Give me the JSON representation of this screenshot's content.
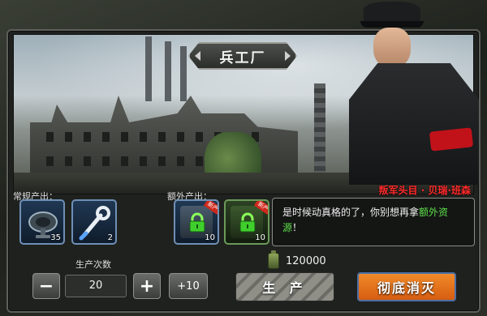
{
  "title": "兵工厂",
  "boss": {
    "name": "叛军头目 · 贝瑞·班森"
  },
  "regular_output": {
    "label": "常规产出：",
    "items": [
      {
        "icon": "radar-dish-icon",
        "count": "35"
      },
      {
        "icon": "wrench-icon",
        "count": "2"
      }
    ]
  },
  "extra_output": {
    "label": "额外产出：",
    "items": [
      {
        "icon": "lock-icon",
        "count": "10",
        "tag": "新产"
      },
      {
        "icon": "lock-icon",
        "count": "10",
        "tag": "新产"
      }
    ]
  },
  "dialog": {
    "text_before": "是时候动真格的了，你别想再拿",
    "text_highlight": "额外资源",
    "text_after": "！"
  },
  "production": {
    "label": "生产次数",
    "quantity": "20",
    "minus": "−",
    "plus": "+",
    "plus10": "+10"
  },
  "cost": {
    "amount": "120000",
    "icon": "fuel-canister-icon"
  },
  "buttons": {
    "produce": "生 产",
    "destroy": "彻底消灭"
  },
  "colors": {
    "boss_name": "#ff2a2a",
    "highlight": "#5ee04a",
    "destroy_button": "#e9721a"
  }
}
